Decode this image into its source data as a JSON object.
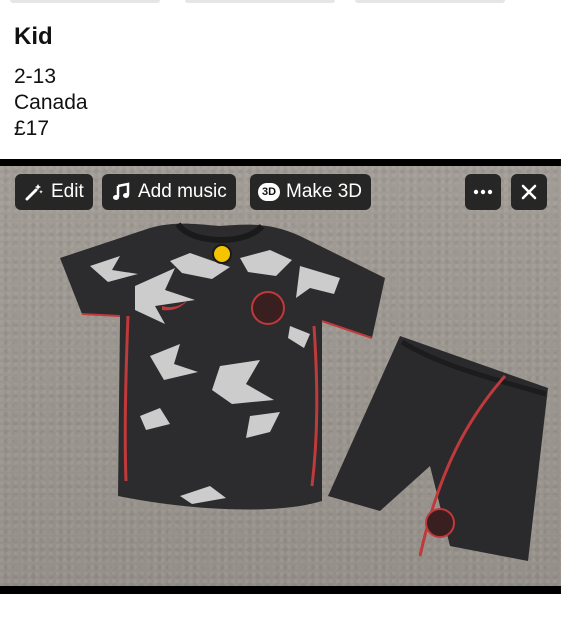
{
  "post": {
    "title": "Kid",
    "lines": [
      "2-13",
      "Canada",
      "£17"
    ]
  },
  "toolbar": {
    "edit_label": "Edit",
    "add_music_label": "Add music",
    "make_3d_label": "Make 3D",
    "badge_3d_text": "3D",
    "more_icon": "more-horizontal-icon",
    "close_icon": "close-icon"
  },
  "colors": {
    "background": "#ffffff",
    "divider": "#000000",
    "toolbar_button": "#1c1c1c",
    "toolbar_text": "#ffffff",
    "kit_base": "#2b2b2d",
    "kit_trim": "#c0393b"
  }
}
